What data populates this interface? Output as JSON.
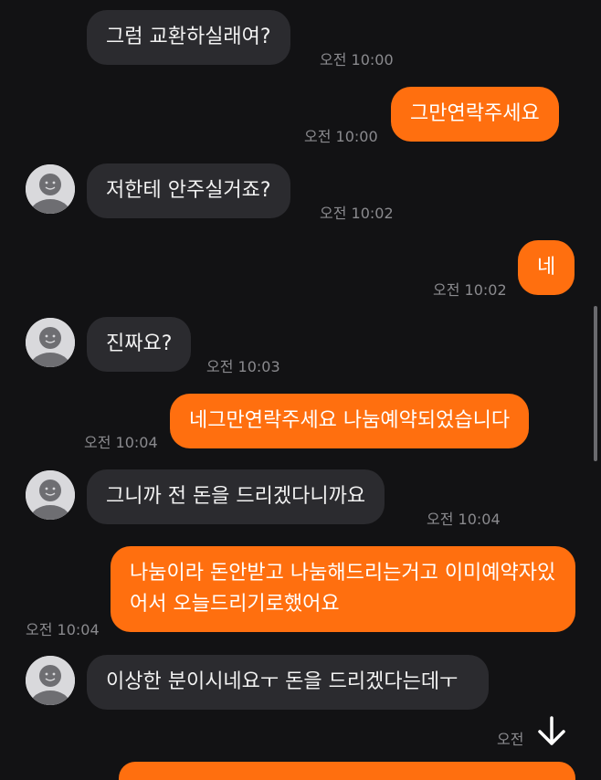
{
  "messages": [
    {
      "id": "m1",
      "side": "in",
      "text": "그럼 교환하실래여?",
      "time": "오전 10:00"
    },
    {
      "id": "m2",
      "side": "out",
      "text": "그만연락주세요",
      "time": "오전 10:00"
    },
    {
      "id": "m3",
      "side": "in",
      "text": "저한테 안주실거죠?",
      "time": "오전 10:02"
    },
    {
      "id": "m4",
      "side": "out",
      "text": "네",
      "time": "오전 10:02"
    },
    {
      "id": "m5",
      "side": "in",
      "text": "진짜요?",
      "time": "오전 10:03"
    },
    {
      "id": "m6",
      "side": "out",
      "text": "네그만연락주세요 나눔예약되었습니다",
      "time": "오전 10:04"
    },
    {
      "id": "m7",
      "side": "in",
      "text": "그니까 전 돈을 드리겠다니까요",
      "time": "오전 10:04"
    },
    {
      "id": "m8",
      "side": "out",
      "text": "나눔이라 돈안받고 나눔해드리는거고 이미예약자있어서 오늘드리기로했어요",
      "time": "오전 10:04"
    },
    {
      "id": "m9",
      "side": "in",
      "text": "이상한 분이시네요ㅜ 돈을 드리겠다는데ㅜ",
      "time": "오전"
    }
  ],
  "icons": {
    "avatar": "default-user-avatar",
    "scroll_down": "arrow-down-icon"
  },
  "colors": {
    "background": "#121214",
    "incoming_bubble": "#2b2b2f",
    "outgoing_bubble": "#ff6f0f",
    "time_text": "#8a8a8e"
  }
}
